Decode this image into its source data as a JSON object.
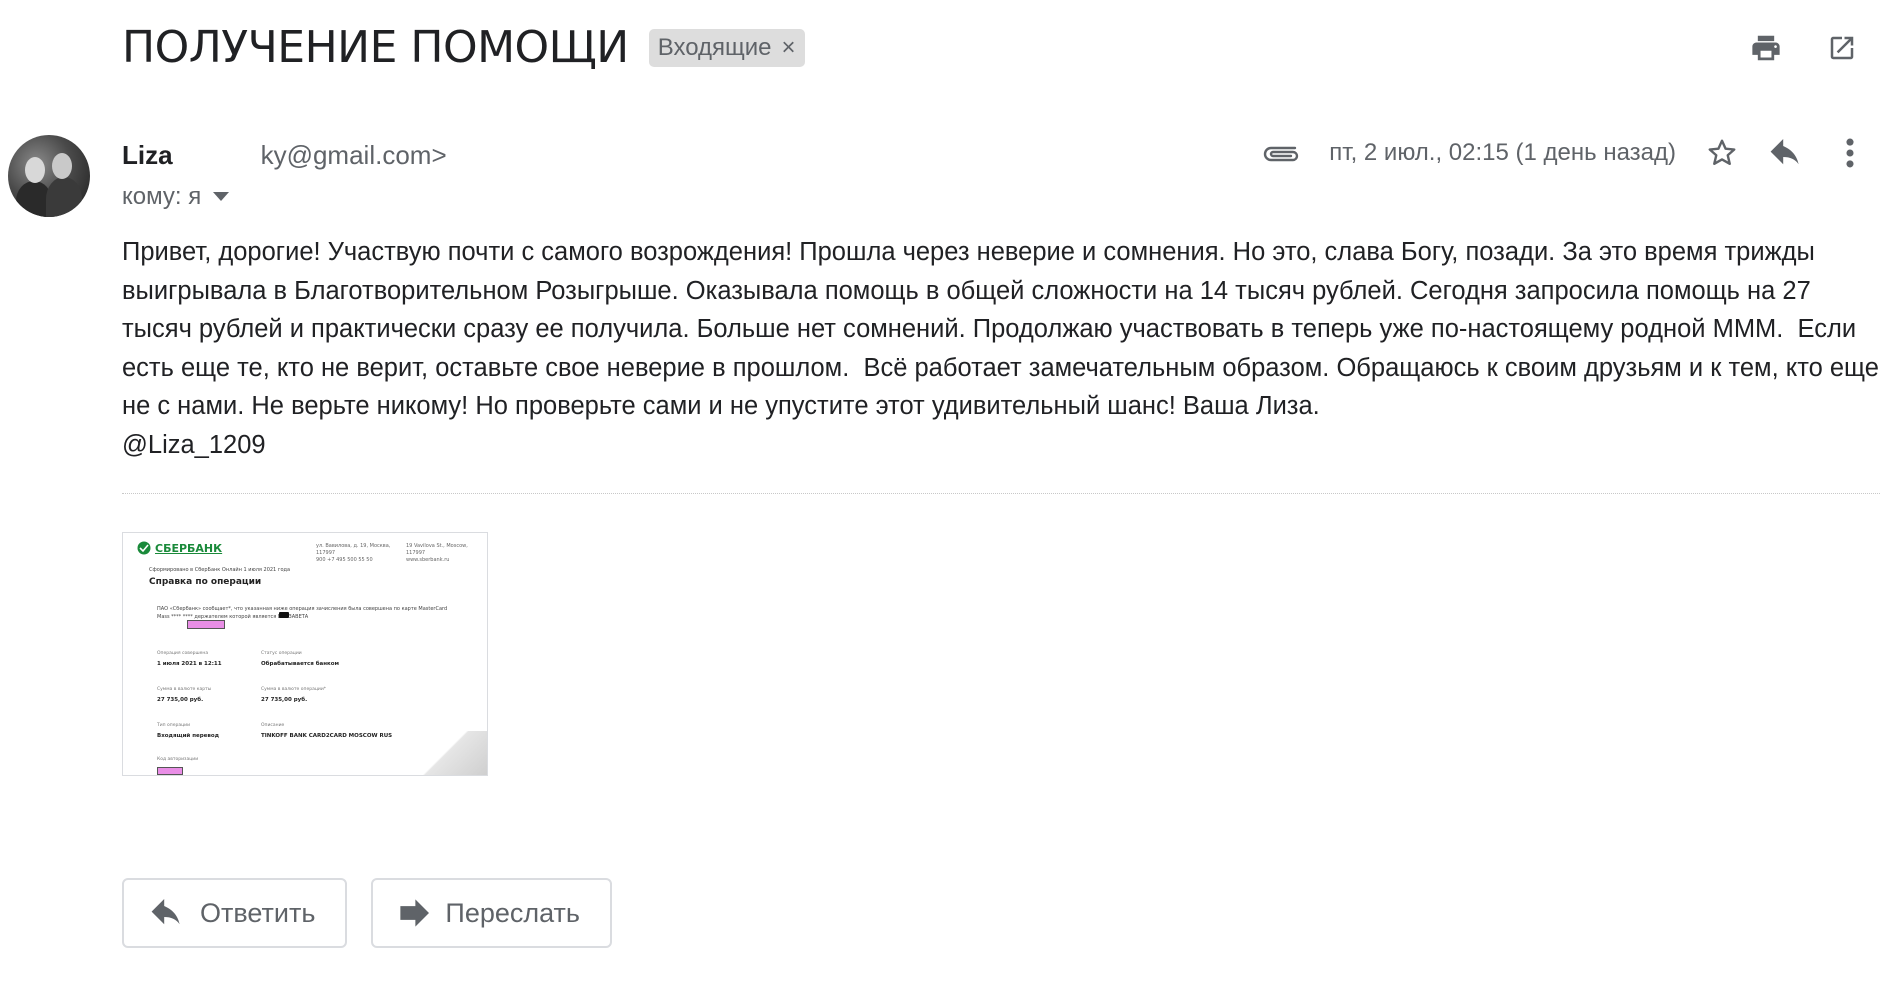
{
  "subject": "ПОЛУЧЕНИЕ ПОМОЩИ",
  "label_chip": {
    "text": "Входящие",
    "remove_glyph": "×"
  },
  "top_icons": [
    "print-icon",
    "open-in-new-window-icon"
  ],
  "sender": {
    "name": "Liza",
    "email_fragment": "ky@gmail.com>"
  },
  "recipient": {
    "text": "кому: я"
  },
  "meta": {
    "date": "пт, 2 июл., 02:15 (1 день назад)",
    "icons": [
      "attachment-icon",
      "star-icon",
      "reply-icon",
      "more-vert-icon"
    ]
  },
  "message_body": "Привет, дорогие! Участвую почти с самого возрождения! Прошла через неверие и сомнения. Но это, слава Богу, позади. За это время трижды выигрывала в Благотворительном Розыгрыше. Оказывала помощь в общей сложности на 14 тысяч рублей. Сегодня запросила помощь на 27 тысяч рублей и практически сразу ее получила. Больше нет сомнений. Продолжаю участвовать в теперь уже по-настоящему родной МММ.  Если есть еще те, кто не верит, оставьте свое неверие в прошлом.  Всё работает замечательным образом. Обращаюсь к своим друзьям и к тем, кто еще не с нами. Не верьте никому! Но проверьте сами и не упустите этот удивительный шанс! Ваша Лиза.\n@Liza_1209",
  "attachment": {
    "bank_name": "СБЕРБАНК",
    "address_1": "ул. Вавилова, д. 19, Москва, 117997\n900 +7 495 500 55 50",
    "address_2": "19 Vavilova St., Moscow, 117997\nwww.sberbank.ru",
    "formed_line": "Сформировано в СберБанк Онлайн 1 июля 2021 года",
    "heading": "Справка по операции",
    "intro": "ПАО «Сбербанк» сообщает*, что указанная ниже операция зачисления была совершена по карте MasterCard Mass **** **** держателем которой является ЕЛИЗАВЕТА",
    "fields": [
      {
        "label": "Операция совершена",
        "value": "1 июля 2021 в 12:11"
      },
      {
        "label": "Статус операции",
        "value": "Обрабатывается банком"
      },
      {
        "label": "Сумма в валюте карты",
        "value": "27 735,00 руб."
      },
      {
        "label": "Сумма в валюте операции*",
        "value": "27 735,00 руб."
      },
      {
        "label": "Тип операции",
        "value": "Входящий перевод"
      },
      {
        "label": "Описание",
        "value": "TINKOFF BANK CARD2CARD MOSCOW RUS"
      },
      {
        "label": "Код авторизации",
        "value": ""
      }
    ]
  },
  "buttons": {
    "reply": "Ответить",
    "forward": "Переслать"
  },
  "colors": {
    "text": "#202124",
    "secondary": "#5f6368",
    "chip_bg": "#dddddd",
    "border": "#dadce0",
    "sber_green": "#1a8a3a",
    "redaction_pink": "#e98ee6"
  }
}
